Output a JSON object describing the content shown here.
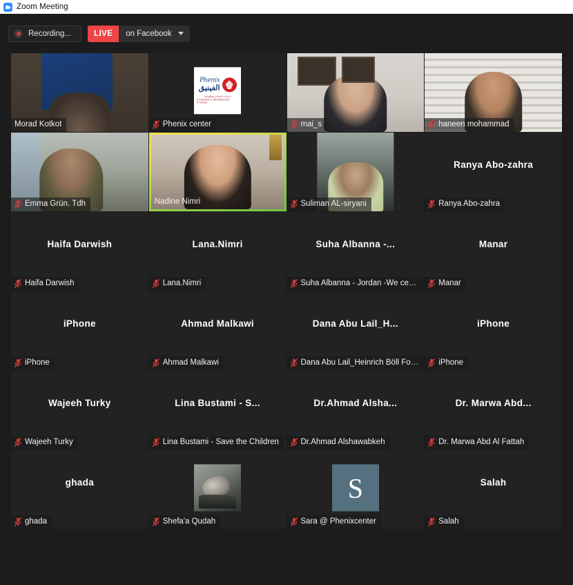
{
  "window": {
    "title": "Zoom Meeting",
    "app_icon": "zoom-video-icon"
  },
  "toolbar": {
    "recording_label": "Recording...",
    "recording_icon": "record-dot-icon",
    "live_badge": "LIVE",
    "live_platform": "on Facebook",
    "caret_icon": "chevron-down-icon"
  },
  "colors": {
    "live_red": "#ef4444",
    "active_speaker_border_start": "#f2e14b",
    "active_speaker_border_end": "#6fc83f",
    "mute_icon_red": "#d93b3b",
    "tile_background": "#222222",
    "window_background": "#1c1c1c",
    "avatar_initial_background": "#55707f"
  },
  "gallery": {
    "columns": 4,
    "rows": 6,
    "participants": [
      {
        "name": "Morad Kotkot",
        "display_name": "Morad Kotkot",
        "muted": false,
        "video": true,
        "active_speaker": false,
        "visual": "bg-morad"
      },
      {
        "name": "Phenix center",
        "display_name": "Phenix center",
        "muted": true,
        "video": true,
        "active_speaker": false,
        "visual": "phenix-logo",
        "logo": {
          "latin": "Phenix",
          "arabic": "الفينيق",
          "sub_arabic": "دراسات اقتصادية ومعلوماتية",
          "sub_latin": "ECONOMIC & INFORMATICS STUDIES"
        }
      },
      {
        "name": "mai_s",
        "display_name": "mai_s",
        "muted": true,
        "video": true,
        "active_speaker": false,
        "visual": "bg-mais"
      },
      {
        "name": "haneen mohammad",
        "display_name": "haneen mohammad",
        "muted": true,
        "video": true,
        "active_speaker": false,
        "visual": "bg-haneen"
      },
      {
        "name": "Emma Grün. Tdh",
        "display_name": "Emma Grün. Tdh",
        "muted": true,
        "video": true,
        "active_speaker": false,
        "visual": "bg-emma"
      },
      {
        "name": "Nadine Nimri",
        "display_name": "Nadine Nimri",
        "muted": false,
        "video": true,
        "active_speaker": true,
        "visual": "bg-nadine"
      },
      {
        "name": "Suliman AL-siryani",
        "display_name": "Suliman AL-siryani",
        "muted": true,
        "video": true,
        "active_speaker": false,
        "visual": "bg-suliman",
        "narrow": true
      },
      {
        "name": "Ranya Abo-zahra",
        "display_name": "Ranya Abo-zahra",
        "muted": true,
        "video": false,
        "active_speaker": false,
        "center_text": "Ranya Abo-zahra"
      },
      {
        "name": "Haifa Darwish",
        "display_name": "Haifa Darwish",
        "muted": true,
        "video": false,
        "active_speaker": false,
        "center_text": "Haifa Darwish"
      },
      {
        "name": "Lana.Nimri",
        "display_name": "Lana.Nimri",
        "muted": true,
        "video": false,
        "active_speaker": false,
        "center_text": "Lana.Nimri"
      },
      {
        "name": "Suha Albanna",
        "display_name": "Suha Albanna - Jordan -We center",
        "muted": true,
        "video": false,
        "active_speaker": false,
        "center_text": "Suha Albanna -..."
      },
      {
        "name": "Manar",
        "display_name": "Manar",
        "muted": true,
        "video": false,
        "active_speaker": false,
        "center_text": "Manar"
      },
      {
        "name": "iPhone",
        "display_name": "iPhone",
        "muted": true,
        "video": false,
        "active_speaker": false,
        "center_text": "iPhone"
      },
      {
        "name": "Ahmad Malkawi",
        "display_name": "Ahmad Malkawi",
        "muted": true,
        "video": false,
        "active_speaker": false,
        "center_text": "Ahmad Malkawi"
      },
      {
        "name": "Dana Abu Lail",
        "display_name": "Dana Abu Lail_Heinrich Böll Foun...",
        "muted": true,
        "video": false,
        "active_speaker": false,
        "center_text": "Dana Abu Lail_H..."
      },
      {
        "name": "iPhone 2",
        "display_name": "iPhone",
        "muted": true,
        "video": false,
        "active_speaker": false,
        "center_text": "iPhone"
      },
      {
        "name": "Wajeeh Turky",
        "display_name": "Wajeeh Turky",
        "muted": true,
        "video": false,
        "active_speaker": false,
        "center_text": "Wajeeh Turky"
      },
      {
        "name": "Lina Bustami",
        "display_name": "Lina Bustami - Save the Children",
        "muted": true,
        "video": false,
        "active_speaker": false,
        "center_text": "Lina Bustami - S..."
      },
      {
        "name": "Dr.Ahmad Alshawabkeh",
        "display_name": "Dr.Ahmad Alshawabkeh",
        "muted": true,
        "video": false,
        "active_speaker": false,
        "center_text": "Dr.Ahmad Alsha..."
      },
      {
        "name": "Dr. Marwa Abd Al Fattah",
        "display_name": "Dr. Marwa Abd Al Fattah",
        "muted": true,
        "video": false,
        "active_speaker": false,
        "center_text": "Dr. Marwa Abd..."
      },
      {
        "name": "ghada",
        "display_name": "ghada",
        "muted": true,
        "video": false,
        "active_speaker": false,
        "center_text": "ghada"
      },
      {
        "name": "Shefa'a Qudah",
        "display_name": "Shefa'a Qudah",
        "muted": true,
        "video": false,
        "active_speaker": false,
        "visual": "photo-avatar"
      },
      {
        "name": "Sara @ Phenixcenter",
        "display_name": "Sara @ Phenixcenter",
        "muted": true,
        "video": false,
        "active_speaker": false,
        "visual": "initial-avatar",
        "initial": "S"
      },
      {
        "name": "Salah",
        "display_name": "Salah",
        "muted": true,
        "video": false,
        "active_speaker": false,
        "center_text": "Salah"
      }
    ]
  }
}
